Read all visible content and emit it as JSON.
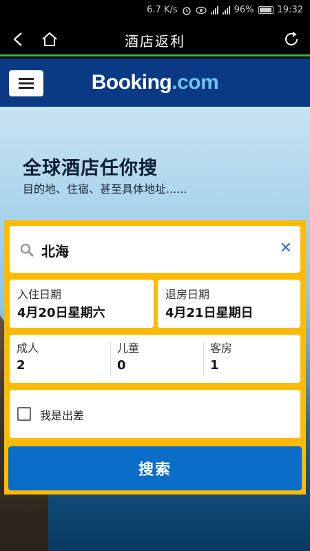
{
  "status_bar": {
    "net_speed": "6.7 K/s",
    "battery": "96%",
    "time": "19:32",
    "icons": [
      "alarm-icon",
      "eye-icon",
      "signal-2g-icon",
      "signal-4g-icon",
      "battery-icon"
    ]
  },
  "nav": {
    "title": "酒店返利",
    "icons": [
      "back-arrow-icon",
      "home-icon",
      "refresh-icon"
    ]
  },
  "brand": {
    "logo_main": "Booking",
    "logo_suffix": ".com",
    "colors": {
      "header": "#0b3a84",
      "form": "#febb02",
      "button": "#0a6ec8",
      "accent_line": "#2fb84a"
    }
  },
  "hero": {
    "title": "全球酒店任你搜",
    "subtitle": "目的地、住宿、甚至具体地址......"
  },
  "search": {
    "value": "北海",
    "icons": [
      "search-icon",
      "clear-icon"
    ]
  },
  "dates": {
    "checkin_label": "入住日期",
    "checkin_value": "4月20日星期六",
    "checkout_label": "退房日期",
    "checkout_value": "4月21日星期日"
  },
  "guests": {
    "adults_label": "成人",
    "adults_value": "2",
    "children_label": "儿童",
    "children_value": "0",
    "rooms_label": "客房",
    "rooms_value": "1"
  },
  "business_trip": {
    "label": "我是出差",
    "checked": false
  },
  "search_button": {
    "label": "搜索"
  }
}
